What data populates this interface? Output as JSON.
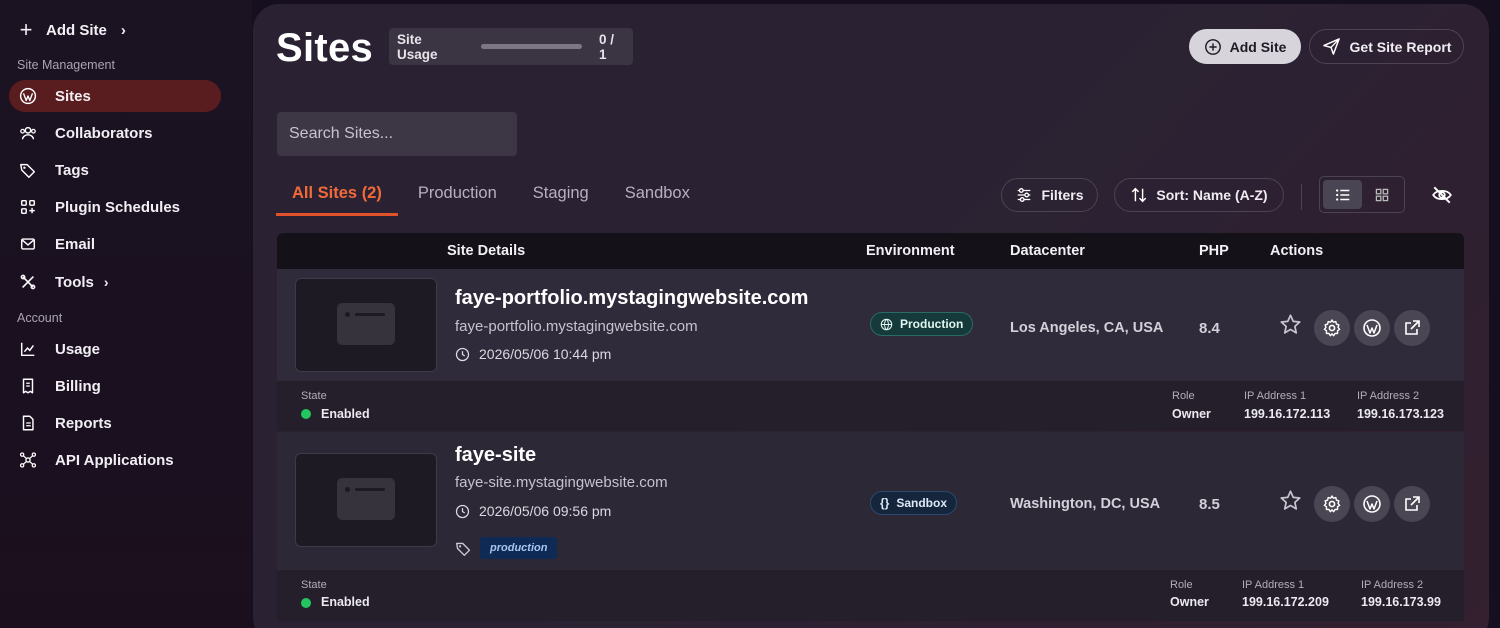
{
  "sidebar": {
    "add_site": "Add Site",
    "section_site_management": "Site Management",
    "section_account": "Account",
    "items": [
      {
        "label": "Sites",
        "icon": "wordpress-icon"
      },
      {
        "label": "Collaborators",
        "icon": "users-icon"
      },
      {
        "label": "Tags",
        "icon": "tags-icon"
      },
      {
        "label": "Plugin Schedules",
        "icon": "plugin-schedules-icon"
      },
      {
        "label": "Email",
        "icon": "email-icon"
      },
      {
        "label": "Tools",
        "icon": "tools-icon"
      },
      {
        "label": "Usage",
        "icon": "chart-line-icon"
      },
      {
        "label": "Billing",
        "icon": "billing-icon"
      },
      {
        "label": "Reports",
        "icon": "reports-icon"
      },
      {
        "label": "API Applications",
        "icon": "api-icon"
      }
    ]
  },
  "header": {
    "title": "Sites",
    "usage_label": "Site Usage",
    "usage_value": "0 / 1",
    "usage_fraction": 0,
    "add_site_label": "Add Site",
    "report_label": "Get Site Report"
  },
  "search": {
    "placeholder": "Search Sites..."
  },
  "tabs": [
    {
      "label": "All Sites (2)",
      "active": true
    },
    {
      "label": "Production"
    },
    {
      "label": "Staging"
    },
    {
      "label": "Sandbox"
    }
  ],
  "toolbar": {
    "filters_label": "Filters",
    "sort_label": "Sort: Name (A-Z)"
  },
  "table": {
    "headers": {
      "site_details": "Site Details",
      "environment": "Environment",
      "datacenter": "Datacenter",
      "php": "PHP",
      "actions": "Actions"
    },
    "rows": [
      {
        "name": "faye-portfolio.mystagingwebsite.com",
        "url": "faye-portfolio.mystagingwebsite.com",
        "date": "2026/05/06 10:44 pm",
        "environment": "Production",
        "datacenter": "Los Angeles, CA, USA",
        "php": "8.4",
        "state_label": "State",
        "state": "Enabled",
        "role_label": "Role",
        "role": "Owner",
        "ip1_label": "IP Address 1",
        "ip1": "199.16.172.113",
        "ip2_label": "IP Address 2",
        "ip2": "199.16.173.123"
      },
      {
        "name": "faye-site",
        "url": "faye-site.mystagingwebsite.com",
        "date": "2026/05/06 09:56 pm",
        "tag": "production",
        "environment": "Sandbox",
        "datacenter": "Washington, DC, USA",
        "php": "8.5",
        "state_label": "State",
        "state": "Enabled",
        "role_label": "Role",
        "role": "Owner",
        "ip1_label": "IP Address 1",
        "ip1": "199.16.172.209",
        "ip2_label": "IP Address 2",
        "ip2": "199.16.173.99"
      }
    ]
  },
  "colors": {
    "accent": "#e2522a",
    "active_nav": "#5a1d1f",
    "enabled_dot": "#22c55e"
  }
}
